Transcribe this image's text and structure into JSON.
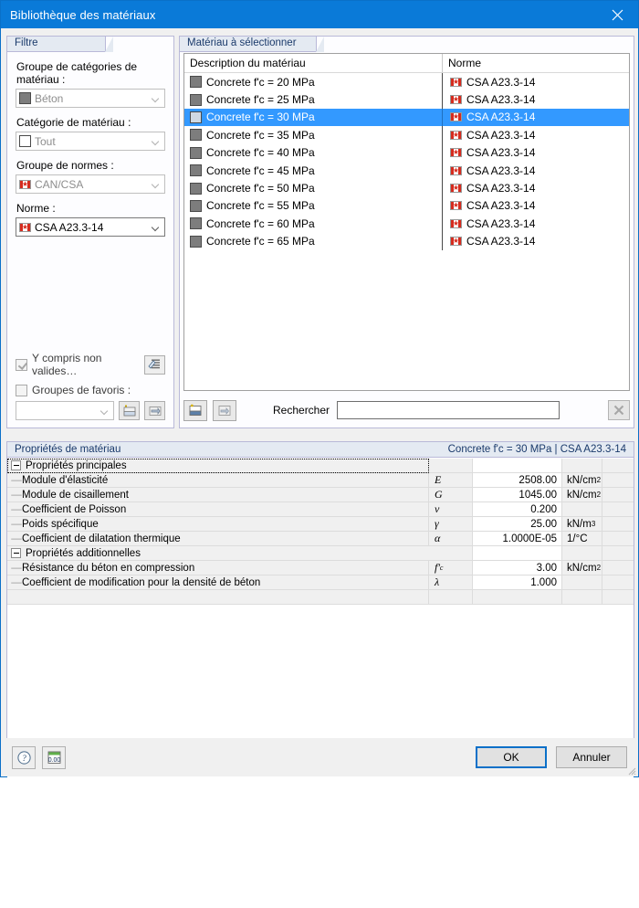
{
  "window": {
    "title": "Bibliothèque des matériaux",
    "close_icon": "close-icon"
  },
  "filter": {
    "header": "Filtre",
    "fields": [
      {
        "label": "Groupe de catégories de matériau :",
        "value": "Béton",
        "icon": "gray-square-icon",
        "enabled": false
      },
      {
        "label": "Catégorie de matériau :",
        "value": "Tout",
        "icon": "white-square-icon",
        "enabled": false
      },
      {
        "label": "Groupe de normes :",
        "value": "CAN/CSA",
        "icon": "canada-flag-icon",
        "enabled": false
      },
      {
        "label": "Norme :",
        "value": "CSA A23.3-14",
        "icon": "canada-flag-icon",
        "enabled": true
      }
    ],
    "include_invalid": {
      "label": "Y compris non valides…",
      "checked": true
    },
    "favorites": {
      "label": "Groupes de favoris :",
      "checked": false,
      "value": ""
    },
    "icons": {
      "filter_settings": "filter-settings-icon",
      "new_folder": "new-folder-icon",
      "open_folder": "open-folder-icon"
    }
  },
  "material_list": {
    "header": "Matériau à sélectionner",
    "columns": [
      "Description du matériau",
      "Norme"
    ],
    "rows": [
      {
        "description": "Concrete f'c = 20 MPa",
        "standard": "CSA A23.3-14",
        "selected": false
      },
      {
        "description": "Concrete f'c = 25 MPa",
        "standard": "CSA A23.3-14",
        "selected": false
      },
      {
        "description": "Concrete f'c = 30 MPa",
        "standard": "CSA A23.3-14",
        "selected": true
      },
      {
        "description": "Concrete f'c = 35 MPa",
        "standard": "CSA A23.3-14",
        "selected": false
      },
      {
        "description": "Concrete f'c = 40 MPa",
        "standard": "CSA A23.3-14",
        "selected": false
      },
      {
        "description": "Concrete f'c = 45 MPa",
        "standard": "CSA A23.3-14",
        "selected": false
      },
      {
        "description": "Concrete f'c = 50 MPa",
        "standard": "CSA A23.3-14",
        "selected": false
      },
      {
        "description": "Concrete f'c = 55 MPa",
        "standard": "CSA A23.3-14",
        "selected": false
      },
      {
        "description": "Concrete f'c = 60 MPa",
        "standard": "CSA A23.3-14",
        "selected": false
      },
      {
        "description": "Concrete f'c = 65 MPa",
        "standard": "CSA A23.3-14",
        "selected": false
      }
    ],
    "search": {
      "label": "Rechercher",
      "value": "",
      "placeholder": ""
    },
    "icons": {
      "new_material": "new-material-icon",
      "import_material": "import-material-icon",
      "clear_search": "clear-x-icon"
    }
  },
  "properties": {
    "header": "Propriétés de matériau",
    "header_right": "Concrete f'c = 30 MPa  |  CSA A23.3-14",
    "groups": [
      {
        "title": "Propriétés principales",
        "rows": [
          {
            "name": "Module d'élasticité",
            "symbol": "E",
            "value": "2508.00",
            "unit": "kN/cm",
            "unit_sup": "2"
          },
          {
            "name": "Module de cisaillement",
            "symbol": "G",
            "value": "1045.00",
            "unit": "kN/cm",
            "unit_sup": "2"
          },
          {
            "name": "Coefficient de Poisson",
            "symbol": "ν",
            "value": "0.200",
            "unit": "",
            "unit_sup": ""
          },
          {
            "name": "Poids spécifique",
            "symbol": "γ",
            "value": "25.00",
            "unit": "kN/m",
            "unit_sup": "3"
          },
          {
            "name": "Coefficient de dilatation thermique",
            "symbol": "α",
            "value": "1.0000E-05",
            "unit": "1/°C",
            "unit_sup": ""
          }
        ]
      },
      {
        "title": "Propriétés additionnelles",
        "rows": [
          {
            "name": "Résistance du béton en compression",
            "symbol": "f'c",
            "value": "3.00",
            "unit": "kN/cm",
            "unit_sup": "2"
          },
          {
            "name": "Coefficient de modification pour la densité de béton",
            "symbol": "λ",
            "value": "1.000",
            "unit": "",
            "unit_sup": ""
          }
        ]
      }
    ]
  },
  "footer": {
    "help_icon": "help-question-icon",
    "units_icon": "units-000-icon",
    "ok_label": "OK",
    "cancel_label": "Annuler"
  },
  "colors": {
    "title_bar": "#0a7ad8",
    "selection": "#3399ff",
    "group_header_bg": "#e4eaf2",
    "group_header_text": "#1a3a6b",
    "accent_border": "#0a70c8"
  }
}
